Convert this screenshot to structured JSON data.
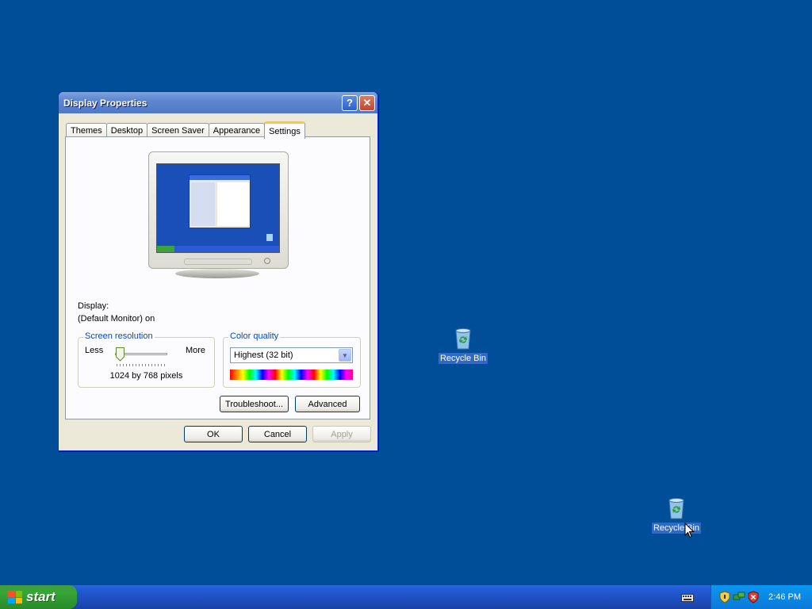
{
  "desktop": {
    "icons": [
      {
        "label": "Recycle Bin",
        "icon": "recycle-bin-icon"
      },
      {
        "label": "Recycle Bin",
        "icon": "recycle-bin-icon"
      }
    ]
  },
  "window": {
    "title": "Display Properties",
    "help_label": "?",
    "close_label": "✕",
    "tabs": [
      {
        "label": "Themes"
      },
      {
        "label": "Desktop"
      },
      {
        "label": "Screen Saver"
      },
      {
        "label": "Appearance"
      },
      {
        "label": "Settings",
        "active": true
      }
    ],
    "display_label": "Display:",
    "display_value": "(Default Monitor) on",
    "resolution": {
      "legend": "Screen resolution",
      "less": "Less",
      "more": "More",
      "value_text": "1024 by 768 pixels",
      "slider_position": 0.1
    },
    "color_quality": {
      "legend": "Color quality",
      "selected": "Highest (32 bit)"
    },
    "buttons": {
      "troubleshoot": "Troubleshoot...",
      "advanced": "Advanced",
      "ok": "OK",
      "cancel": "Cancel",
      "apply": "Apply"
    }
  },
  "taskbar": {
    "start_label": "start",
    "clock": "2:46 PM",
    "tray_icons": [
      "keyboard-icon",
      "security-shield-icon",
      "network-icon",
      "alert-shield-icon"
    ]
  },
  "colors": {
    "desktop": "#004e98",
    "titlebar": "#5e86cf",
    "taskbar": "#245edb",
    "start": "#37a637",
    "tab_highlight": "#ffc73c",
    "group_legend": "#0046d5"
  }
}
